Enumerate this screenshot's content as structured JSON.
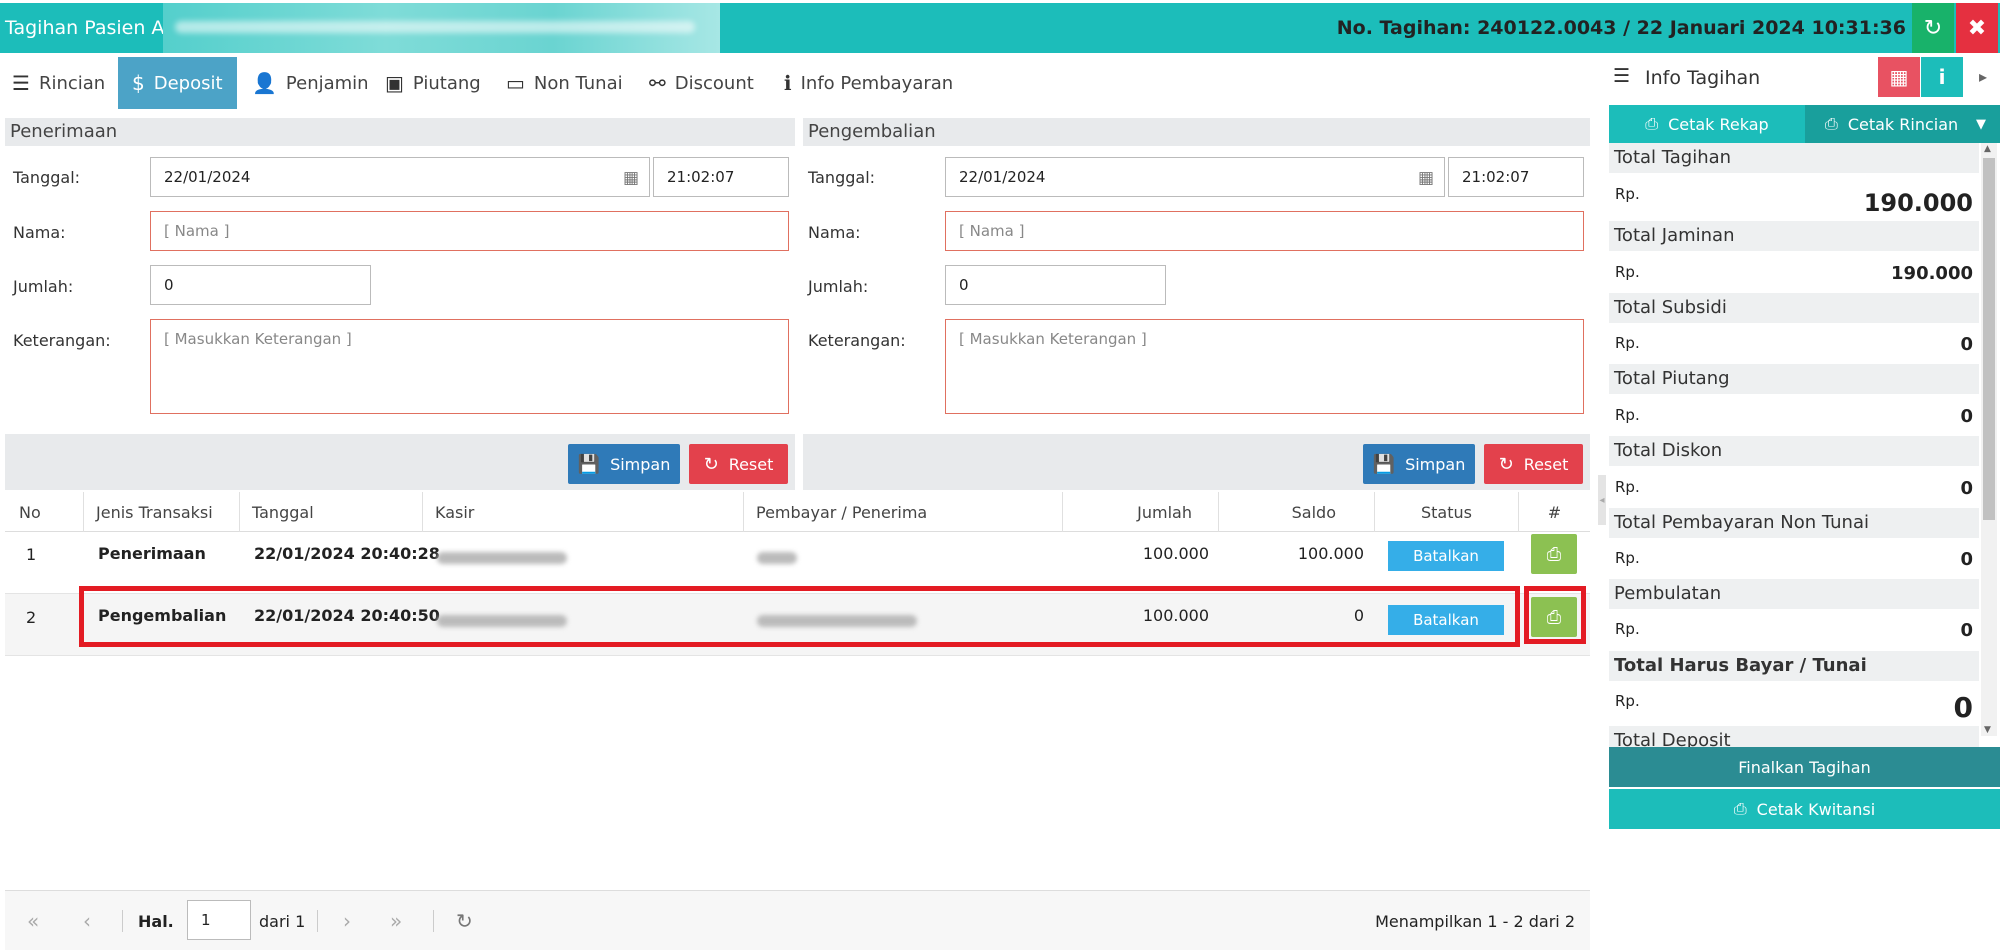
{
  "title": "Tagihan Pasien An.",
  "bill_info": "No. Tagihan: 240122.0043 / 22 Januari 2024 10:31:36",
  "icons": {
    "refresh": "↻",
    "close": "✖"
  },
  "tabs": [
    {
      "label": "Rincian",
      "icon": "☰"
    },
    {
      "label": "Deposit",
      "icon": "$"
    },
    {
      "label": "Penjamin",
      "icon": "👤"
    },
    {
      "label": "Piutang",
      "icon": "▣"
    },
    {
      "label": "Non Tunai",
      "icon": "▭"
    },
    {
      "label": "Discount",
      "icon": "⚯"
    },
    {
      "label": "Info Pembayaran",
      "icon": "ℹ"
    }
  ],
  "penerimaan": {
    "header": "Penerimaan",
    "tanggal_label": "Tanggal:",
    "tanggal": "22/01/2024",
    "jam": "21:02:07",
    "nama_label": "Nama:",
    "nama_placeholder": "[ Nama ]",
    "jumlah_label": "Jumlah:",
    "jumlah": "0",
    "ket_label": "Keterangan:",
    "ket_placeholder": "[ Masukkan Keterangan ]",
    "simpan": "Simpan",
    "reset": "Reset"
  },
  "pengembalian": {
    "header": "Pengembalian",
    "tanggal_label": "Tanggal:",
    "tanggal": "22/01/2024",
    "jam": "21:02:07",
    "nama_label": "Nama:",
    "nama_placeholder": "[ Nama ]",
    "jumlah_label": "Jumlah:",
    "jumlah": "0",
    "ket_label": "Keterangan:",
    "ket_placeholder": "[ Masukkan Keterangan ]",
    "simpan": "Simpan",
    "reset": "Reset"
  },
  "table": {
    "headers": [
      "No",
      "Jenis Transaksi",
      "Tanggal",
      "Kasir",
      "Pembayar / Penerima",
      "Jumlah",
      "Saldo",
      "Status",
      "#"
    ],
    "rows": [
      {
        "no": "1",
        "jenis": "Penerimaan",
        "tanggal": "22/01/2024 20:40:28",
        "jumlah": "100.000",
        "saldo": "100.000",
        "status": "Batalkan"
      },
      {
        "no": "2",
        "jenis": "Pengembalian",
        "tanggal": "22/01/2024 20:40:50",
        "jumlah": "100.000",
        "saldo": "0",
        "status": "Batalkan"
      }
    ]
  },
  "pager": {
    "hal_label": "Hal.",
    "page": "1",
    "dari": "dari 1",
    "showing": "Menampilkan 1 - 2 dari 2"
  },
  "right_panel": {
    "title": "Info Tagihan",
    "cetak_rekap": "Cetak Rekap",
    "cetak_rincian": "Cetak Rincian",
    "summary": [
      {
        "label": "Total Tagihan",
        "currency": "Rp.",
        "value": "190.000"
      },
      {
        "label": "Total Jaminan",
        "currency": "Rp.",
        "value": "190.000"
      },
      {
        "label": "Total Subsidi",
        "currency": "Rp.",
        "value": "0"
      },
      {
        "label": "Total Piutang",
        "currency": "Rp.",
        "value": "0"
      },
      {
        "label": "Total Diskon",
        "currency": "Rp.",
        "value": "0"
      },
      {
        "label": "Total Pembayaran Non Tunai",
        "currency": "Rp.",
        "value": "0"
      },
      {
        "label": "Pembulatan",
        "currency": "Rp.",
        "value": "0"
      },
      {
        "label": "Total Harus Bayar / Tunai",
        "currency": "Rp.",
        "value": "0"
      },
      {
        "label": "Total Deposit",
        "currency": "",
        "value": ""
      }
    ],
    "finalkan": "Finalkan Tagihan",
    "cetak_kwitansi": "Cetak Kwitansi"
  },
  "colors": {
    "header": "#1cbdba",
    "active_tab": "#4ca3c7",
    "primary": "#2f7ab8",
    "danger": "#e3414c",
    "highlight": "#e31b23"
  }
}
